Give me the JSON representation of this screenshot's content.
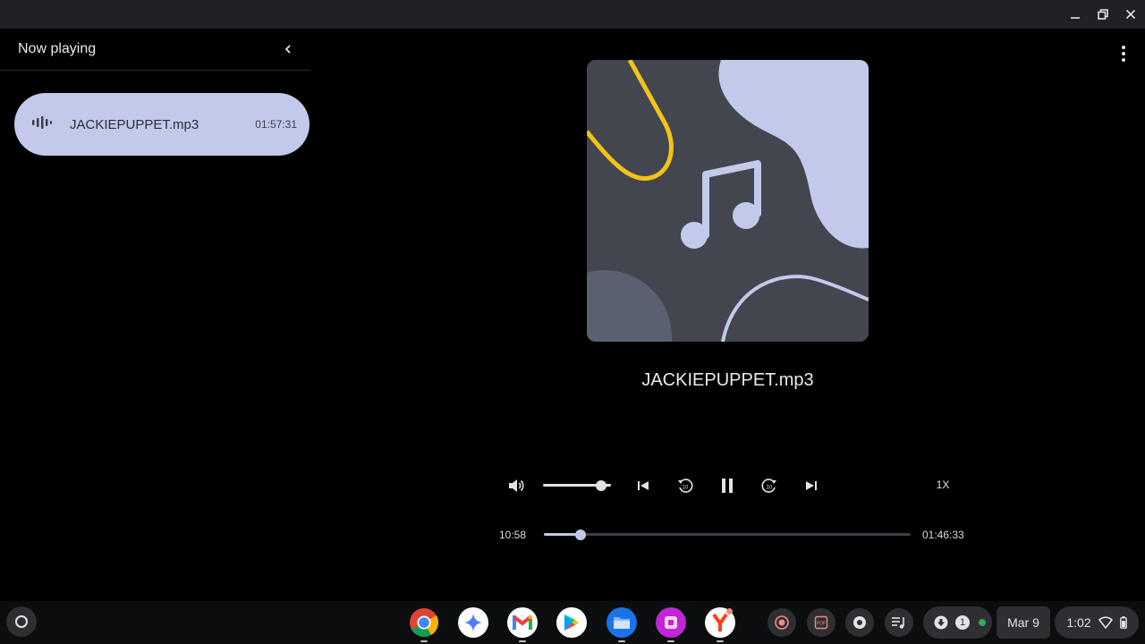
{
  "window": {
    "controls": [
      "minimize",
      "restore",
      "close"
    ]
  },
  "sidebar": {
    "title": "Now playing",
    "collapse_icon": "chevron-left-icon",
    "tracks": [
      {
        "name": "JACKIEPUPPET.mp3",
        "duration": "01:57:31",
        "playing": true
      }
    ]
  },
  "player": {
    "title": "JACKIEPUPPET.mp3",
    "volume_level": 0.92,
    "speed_label": "1X",
    "current_time": "10:58",
    "total_time": "01:46:33",
    "progress": 0.1,
    "state": "playing",
    "art_colors": {
      "background": "#43464f",
      "blob": "#c2c9ea",
      "accent": "#f3c317",
      "dark": "#5b6070"
    }
  },
  "shelf": {
    "apps": [
      "Chrome",
      "Assistant",
      "Gmail",
      "Play Store",
      "Files",
      "App",
      "Yandex"
    ],
    "tray_icons": [
      "screen-record-icon",
      "pdf-icon",
      "media-icon",
      "playlist-icon"
    ],
    "notification_count": "1",
    "date": "Mar 9",
    "time": "1:02"
  }
}
